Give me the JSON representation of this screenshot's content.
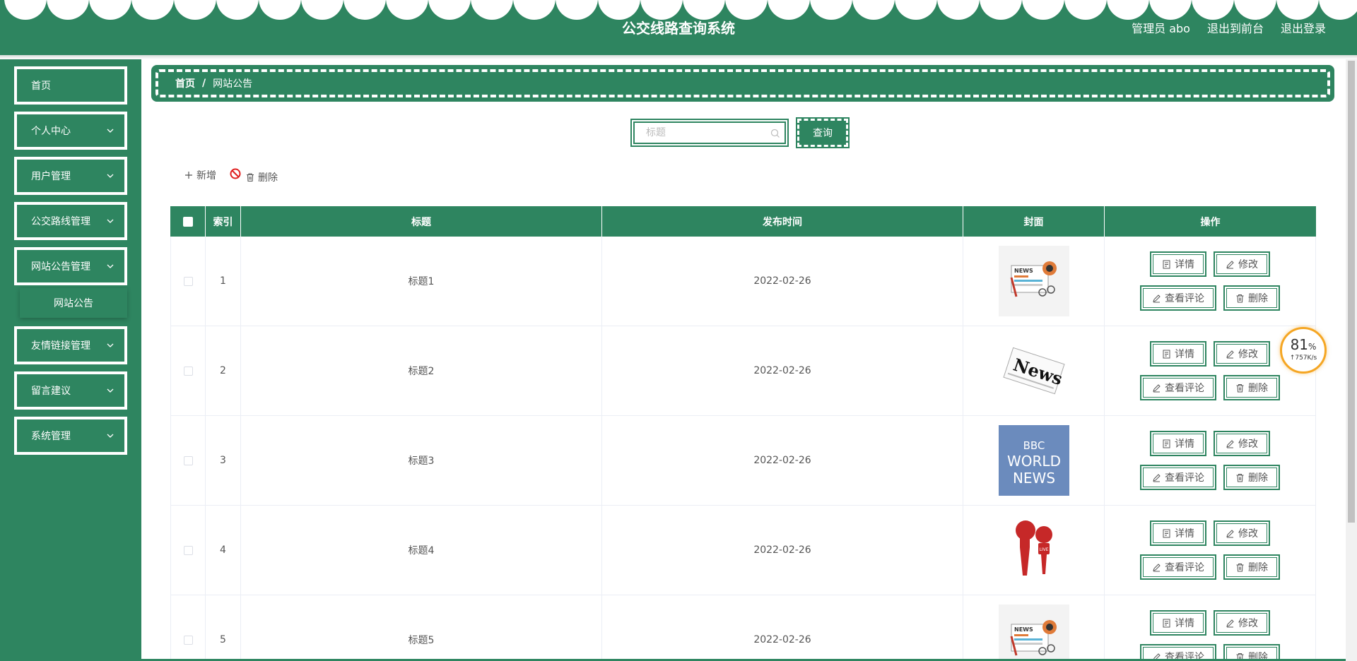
{
  "header": {
    "title": "公交线路查询系统",
    "admin_label": "管理员 abo",
    "front_label": "退出到前台",
    "logout_label": "退出登录"
  },
  "sidebar": {
    "items": [
      {
        "label": "首页"
      },
      {
        "label": "个人中心"
      },
      {
        "label": "用户管理"
      },
      {
        "label": "公交路线管理"
      },
      {
        "label": "网站公告管理"
      },
      {
        "label": "友情链接管理"
      },
      {
        "label": "留言建议"
      },
      {
        "label": "系统管理"
      }
    ],
    "submenu": {
      "label": "网站公告"
    }
  },
  "breadcrumb": {
    "home": "首页",
    "sep": "/",
    "current": "网站公告"
  },
  "search": {
    "placeholder": "标题",
    "button_label": "查询"
  },
  "actions": {
    "add_label": "新增",
    "delete_label": "删除"
  },
  "table": {
    "headers": [
      "索引",
      "标题",
      "发布时间",
      "封面",
      "操作"
    ],
    "rows": [
      {
        "index": "1",
        "title": "标题1",
        "date": "2022-02-26",
        "cover": "news-paper"
      },
      {
        "index": "2",
        "title": "标题2",
        "date": "2022-02-26",
        "cover": "news-print"
      },
      {
        "index": "3",
        "title": "标题3",
        "date": "2022-02-26",
        "cover": "bbc"
      },
      {
        "index": "4",
        "title": "标题4",
        "date": "2022-02-26",
        "cover": "microphones"
      },
      {
        "index": "5",
        "title": "标题5",
        "date": "2022-02-26",
        "cover": "news-paper"
      }
    ],
    "ops": {
      "detail": "详情",
      "edit": "修改",
      "comments": "查看评论",
      "delete": "删除"
    }
  },
  "cover_text": {
    "news_small": "NEWS",
    "news_big": "News",
    "bbc": "BBC",
    "world": "WORLD",
    "news": "NEWS",
    "live": "LIVE"
  },
  "badge": {
    "percent": "81",
    "unit": "%",
    "speed": "↑757K/s"
  },
  "colors": {
    "primary": "#2e8560",
    "badge_ring": "#f5a623"
  }
}
